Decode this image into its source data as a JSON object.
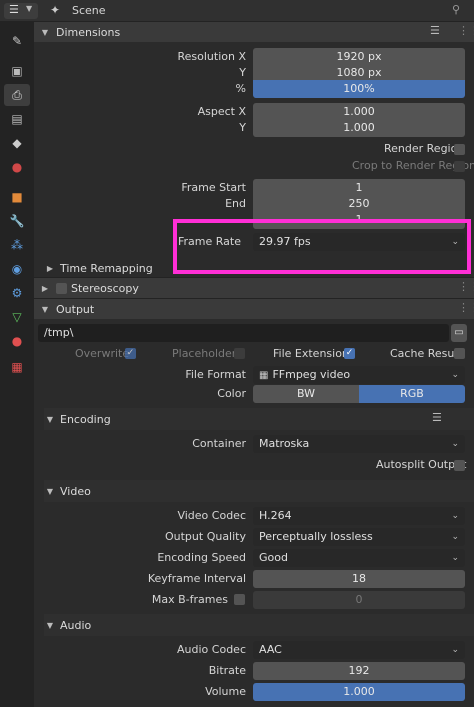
{
  "header": {
    "scene_label": "Scene"
  },
  "sections": {
    "dimensions": "Dimensions",
    "time_remapping": "Time Remapping",
    "stereoscopy": "Stereoscopy",
    "output": "Output",
    "encoding": "Encoding",
    "video": "Video",
    "audio": "Audio"
  },
  "dimensions": {
    "resolution_x_label": "Resolution X",
    "resolution_x": "1920 px",
    "y_label": "Y",
    "resolution_y": "1080 px",
    "percent_label": "%",
    "percent": "100%",
    "aspect_x_label": "Aspect X",
    "aspect_x": "1.000",
    "aspect_y_label": "Y",
    "aspect_y": "1.000",
    "render_region_label": "Render Region",
    "crop_label": "Crop to Render Region",
    "frame_start_label": "Frame Start",
    "frame_start": "1",
    "end_label": "End",
    "frame_end": "250",
    "step_value": "1",
    "frame_rate_label": "Frame Rate",
    "frame_rate": "29.97 fps"
  },
  "output": {
    "path": "/tmp\\",
    "overwrite_label": "Overwrite",
    "placeholders_label": "Placeholders",
    "file_extensions_label": "File Extensions",
    "cache_result_label": "Cache Result",
    "file_format_label": "File Format",
    "file_format": "FFmpeg video",
    "color_label": "Color",
    "color_bw": "BW",
    "color_rgb": "RGB"
  },
  "encoding": {
    "container_label": "Container",
    "container": "Matroska",
    "autosplit_label": "Autosplit Output"
  },
  "video": {
    "codec_label": "Video Codec",
    "codec": "H.264",
    "quality_label": "Output Quality",
    "quality": "Perceptually lossless",
    "speed_label": "Encoding Speed",
    "speed": "Good",
    "keyframe_label": "Keyframe Interval",
    "keyframe": "18",
    "bframes_label": "Max B-frames",
    "bframes": "0"
  },
  "audio": {
    "codec_label": "Audio Codec",
    "codec": "AAC",
    "bitrate_label": "Bitrate",
    "bitrate": "192",
    "volume_label": "Volume",
    "volume": "1.000"
  },
  "colors": {
    "accent": "#4772b3",
    "highlight": "#ff2fd6"
  }
}
